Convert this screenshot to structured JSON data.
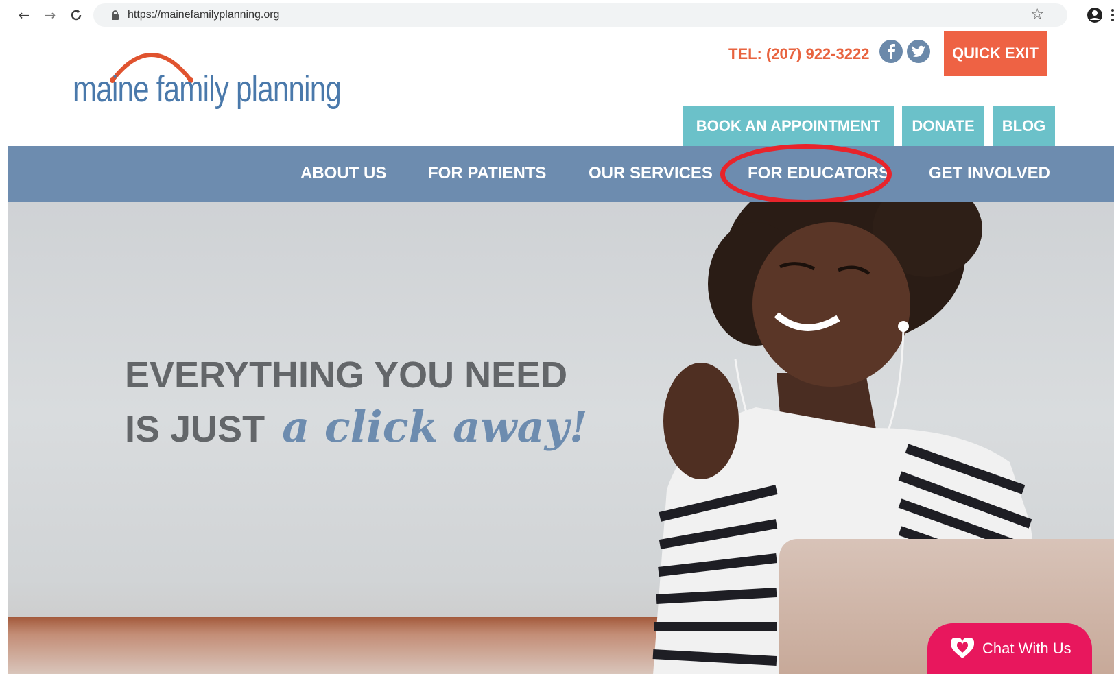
{
  "browser": {
    "url": "https://mainefamilyplanning.org"
  },
  "header": {
    "logo_text": "maine family planning",
    "tel": "TEL: (207) 922-3222",
    "quick_exit": "QUICK EXIT",
    "buttons": [
      {
        "label": "BOOK AN APPOINTMENT"
      },
      {
        "label": "DONATE"
      },
      {
        "label": "BLOG"
      }
    ]
  },
  "nav": {
    "items": [
      {
        "label": "ABOUT US"
      },
      {
        "label": "FOR PATIENTS"
      },
      {
        "label": "OUR SERVICES"
      },
      {
        "label": "FOR EDUCATORS"
      },
      {
        "label": "GET INVOLVED"
      }
    ],
    "highlighted": "FOR EDUCATORS"
  },
  "hero": {
    "line1": "EVERYTHING YOU NEED",
    "line2_prefix": "IS JUST",
    "line2_script": "a click away!"
  },
  "chat": {
    "label": "Chat With Us"
  },
  "colors": {
    "brand_blue": "#4a79ab",
    "nav_blue": "#6d8caf",
    "teal": "#6bc1c9",
    "orange": "#ee6244",
    "chat_pink": "#e8175d",
    "annotation_red": "#e8242b"
  }
}
